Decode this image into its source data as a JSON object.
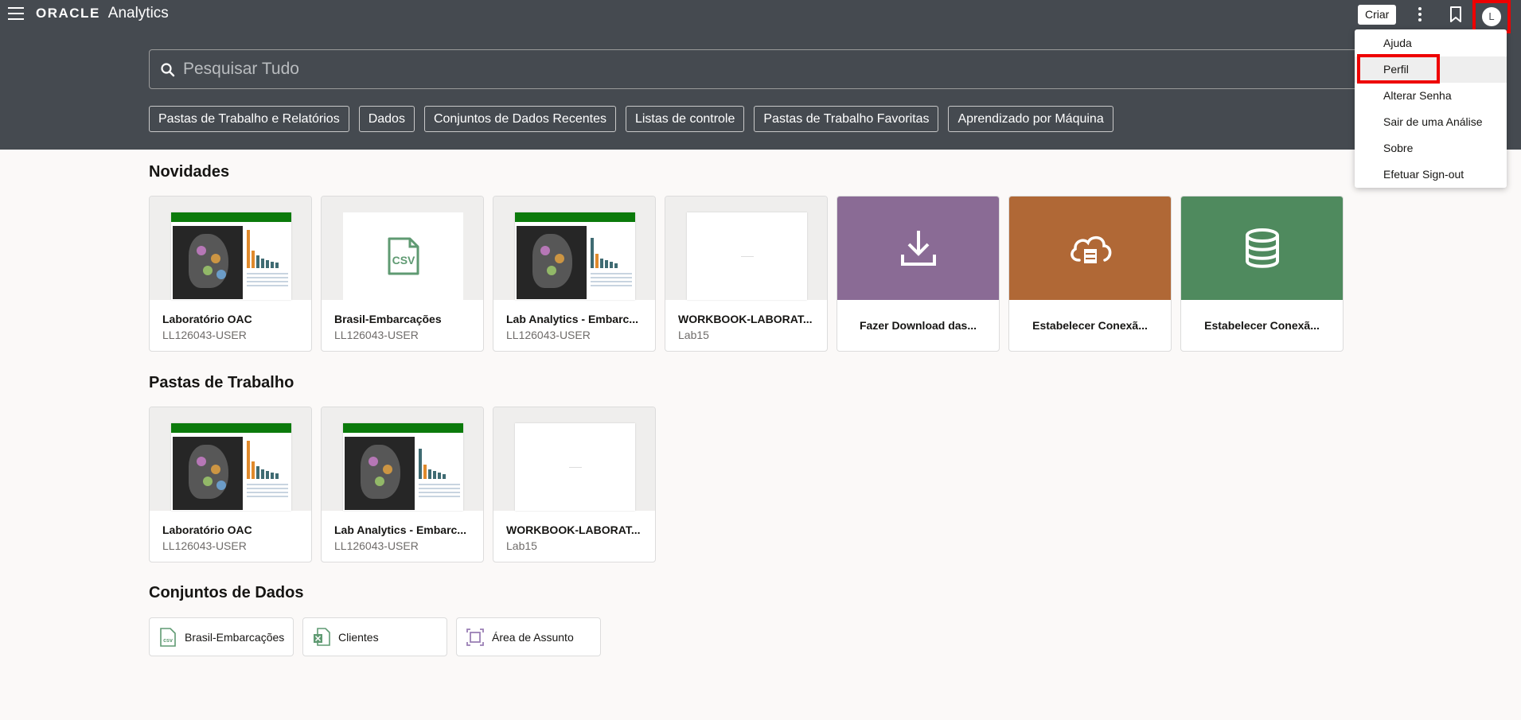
{
  "app": {
    "brand_logo": "ORACLE",
    "brand_name": "Analytics"
  },
  "toolbar": {
    "create_label": "Criar",
    "avatar_letter": "L"
  },
  "search": {
    "placeholder": "Pesquisar Tudo"
  },
  "filters": [
    "Pastas de Trabalho e Relatórios",
    "Dados",
    "Conjuntos de Dados Recentes",
    "Listas de controle",
    "Pastas de Trabalho Favoritas",
    "Aprendizado por Máquina"
  ],
  "sections": {
    "novidades": {
      "title": "Novidades",
      "items": [
        {
          "title": "Laboratório OAC",
          "sub": "LL126043-USER"
        },
        {
          "title": "Brasil-Embarcações",
          "sub": "LL126043-USER",
          "thumb_label": "CSV"
        },
        {
          "title": "Lab Analytics - Embarc...",
          "sub": "LL126043-USER"
        },
        {
          "title": "WORKBOOK-LABORAT...",
          "sub": "Lab15"
        },
        {
          "title": "Fazer Download das...",
          "icon": "download-icon",
          "color": "#8a6b95"
        },
        {
          "title": "Estabelecer Conexã...",
          "icon": "cloud-database-icon",
          "color": "#b06836"
        },
        {
          "title": "Estabelecer Conexã...",
          "icon": "database-icon",
          "color": "#4f8a5e"
        }
      ]
    },
    "pastas": {
      "title": "Pastas de Trabalho",
      "items": [
        {
          "title": "Laboratório OAC",
          "sub": "LL126043-USER"
        },
        {
          "title": "Lab Analytics - Embarc...",
          "sub": "LL126043-USER"
        },
        {
          "title": "WORKBOOK-LABORAT...",
          "sub": "Lab15"
        }
      ]
    },
    "conjuntos": {
      "title": "Conjuntos de Dados",
      "items": [
        {
          "label": "Brasil-Embarcações",
          "icon": "csv-file-icon"
        },
        {
          "label": "Clientes",
          "icon": "excel-file-icon"
        },
        {
          "label": "Área de Assunto",
          "icon": "subject-area-icon"
        }
      ]
    }
  },
  "menu": {
    "items": [
      "Ajuda",
      "Perfil",
      "Alterar Senha",
      "Sair de uma Análise",
      "Sobre",
      "Efetuar Sign-out"
    ],
    "highlighted": "Perfil"
  },
  "colors": {
    "header": "#454a50",
    "highlight": "#ee0000",
    "doc_header": "#0b7a0b"
  }
}
